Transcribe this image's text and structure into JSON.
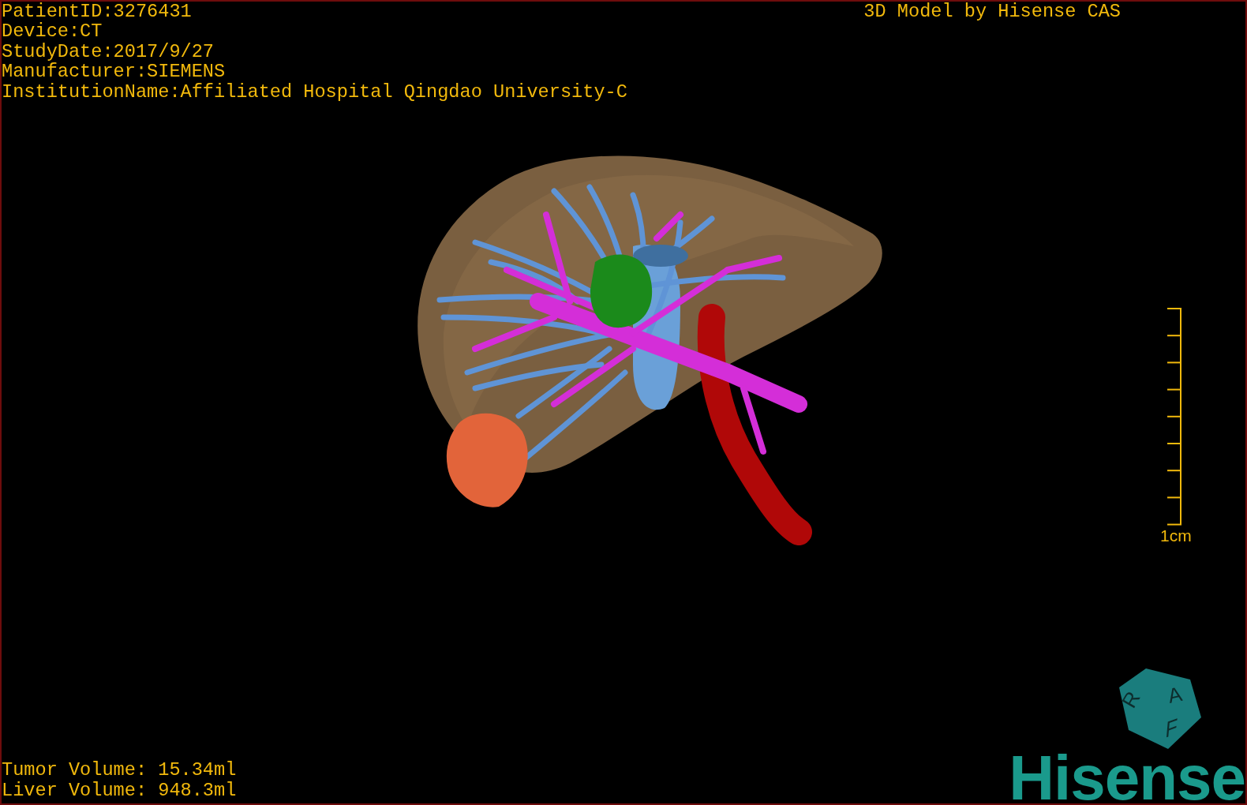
{
  "patient_info": [
    "PatientID:3276431",
    "Device:CT",
    "StudyDate:2017/9/27",
    "Manufacturer:SIEMENS",
    "InstitutionName:Affiliated Hospital Qingdao University-C"
  ],
  "title": "3D Model by Hisense CAS",
  "scale_bar": {
    "label": "1cm"
  },
  "volumes": [
    "Tumor Volume: 15.34ml",
    "Liver Volume: 948.3ml"
  ],
  "orientation_cube": {
    "labels": [
      "A",
      "F",
      "R"
    ]
  },
  "logo": "Hisense"
}
